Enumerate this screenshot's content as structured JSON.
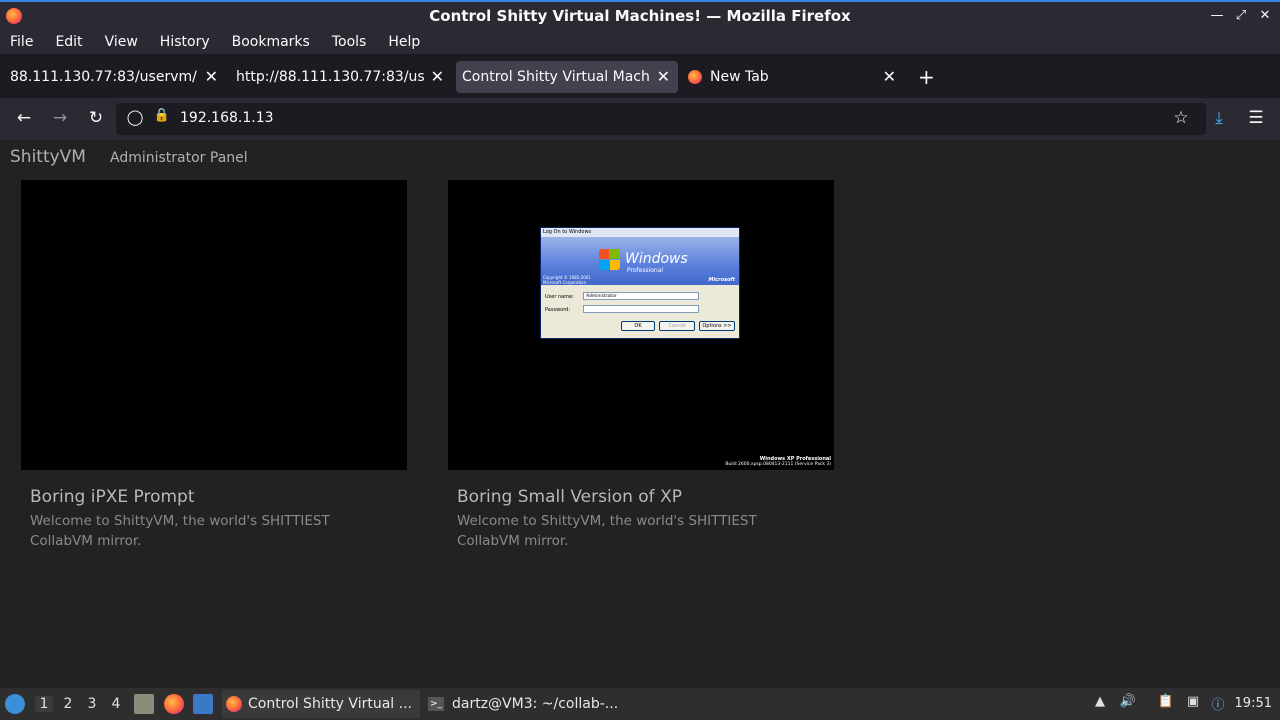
{
  "window": {
    "title": "Control Shitty Virtual Machines! — Mozilla Firefox"
  },
  "menu": [
    "File",
    "Edit",
    "View",
    "History",
    "Bookmarks",
    "Tools",
    "Help"
  ],
  "tabs": [
    {
      "label": "88.111.130.77:83/uservm/"
    },
    {
      "label": "http://88.111.130.77:83/use"
    },
    {
      "label": "Control Shitty Virtual Machines!"
    },
    {
      "label": "New Tab"
    }
  ],
  "url": "192.168.1.13",
  "page": {
    "brand": "ShittyVM",
    "admin_link": "Administrator Panel",
    "vms": [
      {
        "title": "Boring iPXE Prompt",
        "description": "Welcome to ShittyVM, the world's SHITTIEST CollabVM mirror."
      },
      {
        "title": "Boring Small Version of XP",
        "description": "Welcome to ShittyVM, the world's SHITTIEST CollabVM mirror."
      }
    ],
    "xp": {
      "dialog_title": "Log On to Windows",
      "windows": "Windows",
      "edition": "Professional",
      "copyright": "Copyright © 1985-2001 Microsoft Corporation",
      "microsoft": "Microsoft",
      "user_label": "User name:",
      "user_value": "Administrator",
      "password_label": "Password:",
      "ok": "OK",
      "cancel": "Cancel",
      "options": "Options >>",
      "footer_line1": "Windows XP Professional",
      "footer_line2": "Build 2600.xpsp.080413-2111 (Service Pack 3)"
    }
  },
  "taskbar": {
    "desktops": [
      "1",
      "2",
      "3",
      "4"
    ],
    "tasks": [
      {
        "label": "Control Shitty Virtual ..."
      },
      {
        "label": "dartz@VM3: ~/collab-..."
      }
    ],
    "clock": "19:51"
  }
}
